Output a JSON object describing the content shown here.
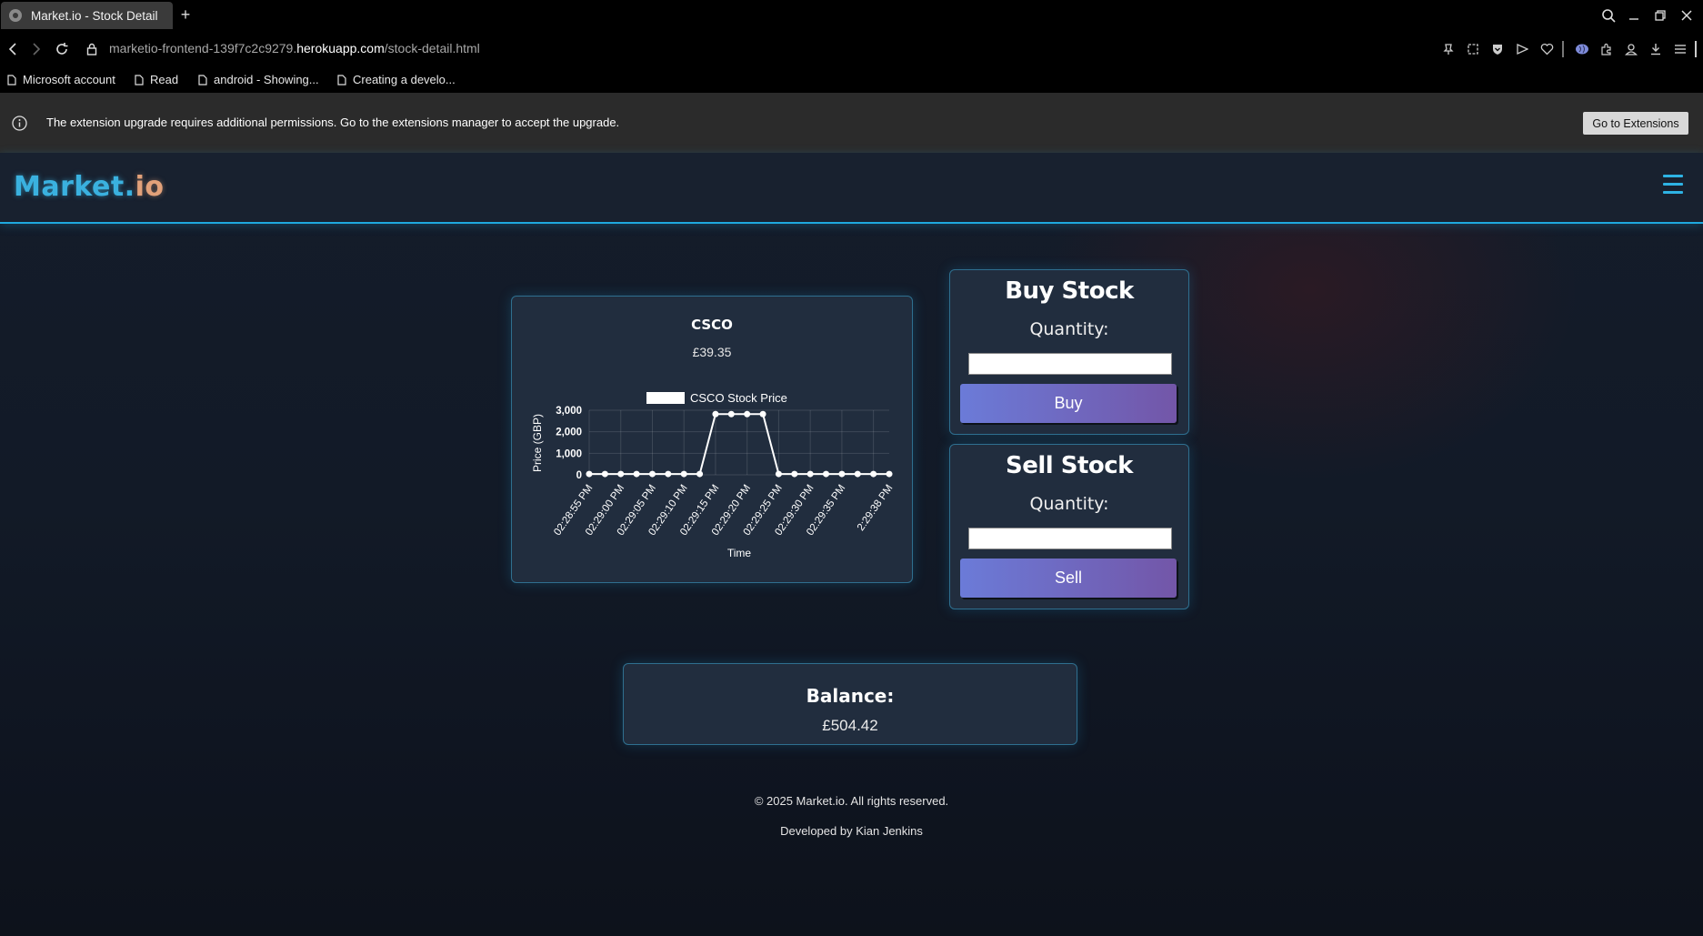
{
  "browser": {
    "tab_title": "Market.io - Stock Detail",
    "url_prefix": "marketio-frontend-139f7c2c9279.",
    "url_host": "herokuapp.com",
    "url_path": "/stock-detail.html",
    "bookmarks": [
      "Microsoft account",
      "Read",
      "android - Showing...",
      "Creating a develo..."
    ],
    "infobar_message": "The extension upgrade requires additional permissions. Go to the extensions manager to accept the upgrade.",
    "infobar_button": "Go to Extensions"
  },
  "site": {
    "logo_main": "Market",
    "logo_dot": ".",
    "logo_tail": "io",
    "accent": "#1fa9df"
  },
  "stock": {
    "symbol": "CSCO",
    "price": "£39.35"
  },
  "chart_data": {
    "type": "line",
    "legend": "CSCO Stock Price",
    "xlabel": "Time",
    "ylabel": "Price (GBP)",
    "yticks": [
      "3,000",
      "2,000",
      "1,000",
      "0"
    ],
    "ylim": [
      0,
      3000
    ],
    "xtick_labels": [
      "02:28:55 PM",
      "02:29:00 PM",
      "02:29:05 PM",
      "02:29:10 PM",
      "02:29:15 PM",
      "02:29:20 PM",
      "02:29:25 PM",
      "02:29:30 PM",
      "02:29:35 PM",
      "2:29:38 PM"
    ],
    "values": [
      39,
      39,
      39,
      39,
      39,
      39,
      39,
      39,
      2820,
      2820,
      2820,
      2820,
      39,
      39,
      39,
      39,
      39,
      39,
      39,
      39
    ],
    "grid": true,
    "legend_position": "top",
    "line_color": "#ffffff"
  },
  "buy": {
    "title": "Buy Stock",
    "label": "Quantity:",
    "button": "Buy",
    "value": ""
  },
  "sell": {
    "title": "Sell Stock",
    "label": "Quantity:",
    "button": "Sell",
    "value": ""
  },
  "balance": {
    "title": "Balance:",
    "value": "£504.42"
  },
  "footer": {
    "copyright": "© 2025 Market.io. All rights reserved.",
    "credit": "Developed by Kian Jenkins"
  }
}
